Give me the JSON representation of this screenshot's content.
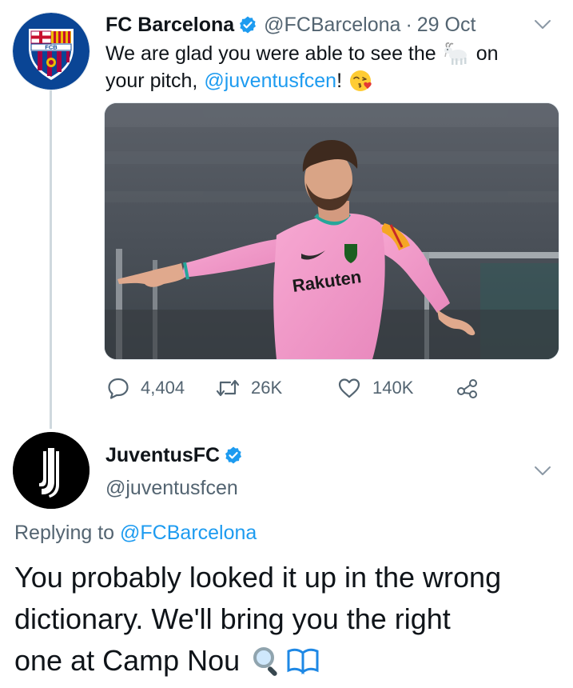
{
  "original_tweet": {
    "display_name": "FC Barcelona",
    "handle": "@FCBarcelona",
    "separator": "·",
    "date": "29 Oct",
    "avatar_label": "FCB",
    "text_line1_before_emoji": "We are glad you were able to see the",
    "text_line1_emoji": "goat-emoji",
    "text_line1_after_emoji": "on",
    "text_line2_before_mention": "your pitch,",
    "mention": "@juventusfcen",
    "text_line2_after_mention": "!",
    "text_line2_emoji": "face-blowing-kiss-emoji",
    "media_jersey_text": "Rakuten",
    "actions": {
      "reply_count": "4,404",
      "retweet_count": "26K",
      "like_count": "140K"
    }
  },
  "reply_tweet": {
    "display_name": "JuventusFC",
    "handle": "@juventusfcen",
    "replying_prefix": "Replying to",
    "replying_to": "@FCBarcelona",
    "line1": "You probably looked it up in the wrong",
    "line2": "dictionary. We'll bring you the right",
    "line3": "one at Camp Nou",
    "emojis": [
      "magnifying-glass-emoji",
      "open-book-emoji"
    ]
  },
  "colors": {
    "link": "#1d9bf0",
    "secondary_text": "#536471",
    "primary_text": "#0f1419",
    "verified_badge": "#1d9bf0",
    "thread_line": "#cfd9de"
  }
}
